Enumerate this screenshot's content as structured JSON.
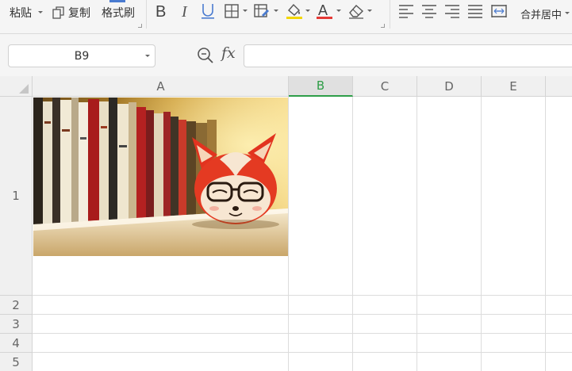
{
  "toolbar": {
    "paste_label": "粘贴",
    "copy_label": "复制",
    "format_painter_label": "格式刷",
    "merge_center_label": "合并居中"
  },
  "formula_bar": {
    "cell_reference": "B9",
    "fx_label": "fx",
    "formula_value": ""
  },
  "sheet": {
    "columns": [
      "A",
      "B",
      "C",
      "D",
      "E"
    ],
    "rows": [
      "1",
      "2",
      "3",
      "4",
      "5"
    ],
    "active_column": "B"
  },
  "colors": {
    "accent_green": "#2e9e48",
    "font_color_underline": "#e53935",
    "fill_color_underline": "#f2d600"
  },
  "icons": [
    "copy-icon",
    "format-painter-icon",
    "bold-icon",
    "italic-icon",
    "underline-icon",
    "border-icon",
    "fill-color-icon",
    "font-color-icon",
    "eraser-icon",
    "align-left-icon",
    "align-center-icon",
    "align-right-icon",
    "justify-icon",
    "distributed-icon",
    "zoom-icon"
  ]
}
